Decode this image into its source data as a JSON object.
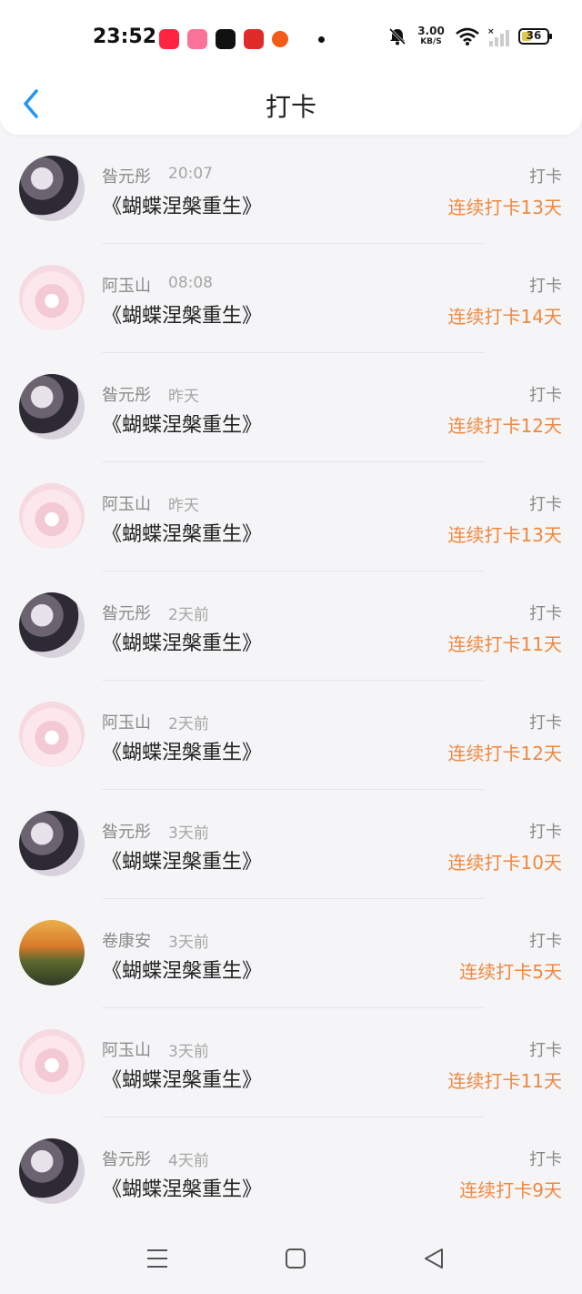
{
  "status": {
    "time": "23:52",
    "net_speed": "3.00",
    "net_unit": "KB/S",
    "battery": "36"
  },
  "header": {
    "title": "打卡"
  },
  "items": [
    {
      "name": "昝元彤",
      "time": "20:07",
      "book": "《蝴蝶涅槃重生》",
      "tag": "打卡",
      "streak": "连续打卡13天",
      "avatar": "dark"
    },
    {
      "name": "阿玉山",
      "time": "08:08",
      "book": "《蝴蝶涅槃重生》",
      "tag": "打卡",
      "streak": "连续打卡14天",
      "avatar": "pink"
    },
    {
      "name": "昝元彤",
      "time": "昨天",
      "book": "《蝴蝶涅槃重生》",
      "tag": "打卡",
      "streak": "连续打卡12天",
      "avatar": "dark"
    },
    {
      "name": "阿玉山",
      "time": "昨天",
      "book": "《蝴蝶涅槃重生》",
      "tag": "打卡",
      "streak": "连续打卡13天",
      "avatar": "pink"
    },
    {
      "name": "昝元彤",
      "time": "2天前",
      "book": "《蝴蝶涅槃重生》",
      "tag": "打卡",
      "streak": "连续打卡11天",
      "avatar": "dark"
    },
    {
      "name": "阿玉山",
      "time": "2天前",
      "book": "《蝴蝶涅槃重生》",
      "tag": "打卡",
      "streak": "连续打卡12天",
      "avatar": "pink"
    },
    {
      "name": "昝元彤",
      "time": "3天前",
      "book": "《蝴蝶涅槃重生》",
      "tag": "打卡",
      "streak": "连续打卡10天",
      "avatar": "dark"
    },
    {
      "name": "卷康安",
      "time": "3天前",
      "book": "《蝴蝶涅槃重生》",
      "tag": "打卡",
      "streak": "连续打卡5天",
      "avatar": "land"
    },
    {
      "name": "阿玉山",
      "time": "3天前",
      "book": "《蝴蝶涅槃重生》",
      "tag": "打卡",
      "streak": "连续打卡11天",
      "avatar": "pink"
    },
    {
      "name": "昝元彤",
      "time": "4天前",
      "book": "《蝴蝶涅槃重生》",
      "tag": "打卡",
      "streak": "连续打卡9天",
      "avatar": "dark"
    }
  ],
  "colors": {
    "accent": "#2196f3",
    "streak": "#f0883e"
  }
}
